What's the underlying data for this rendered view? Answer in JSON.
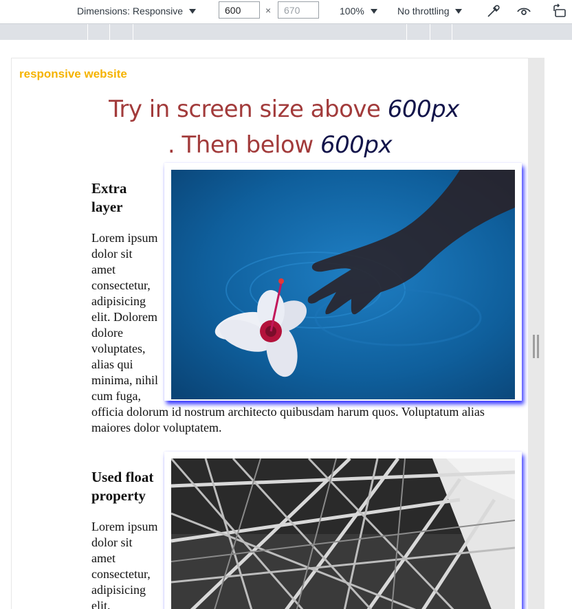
{
  "devtools": {
    "dimensions_label": "Dimensions: Responsive",
    "width_value": "600",
    "height_placeholder": "670",
    "times_symbol": "×",
    "zoom": "100%",
    "throttling": "No throttling",
    "icons": [
      "eyedropper-icon",
      "eye-icon",
      "rotate-icon"
    ]
  },
  "page": {
    "brand": "responsive website",
    "hero": {
      "line1_text": "Try in screen size above ",
      "line1_highlight": "600px",
      "line2_text": ". Then below ",
      "line2_highlight": "600px"
    },
    "cards": [
      {
        "title": "Extra layer",
        "body": "Lorem ipsum dolor sit amet consectetur, adipisicing elit. Dolorem dolore voluptates, alias qui minima, nihil cum fuga, officia dolorum id nostrum architecto quibusdam harum quos. Voluptatum alias maiores dolor voluptatem.",
        "image": "hand-and-hibiscus-in-water-photo"
      },
      {
        "title": "Used float property",
        "body": "Lorem ipsum dolor sit amet consectetur, adipisicing elit.",
        "image": "steel-structure-photo"
      }
    ]
  },
  "colors": {
    "brand": "#f5b300",
    "hero_text": "#a23b3b",
    "hero_highlight": "#12144a",
    "photo_shadow": "#3a3aff"
  }
}
